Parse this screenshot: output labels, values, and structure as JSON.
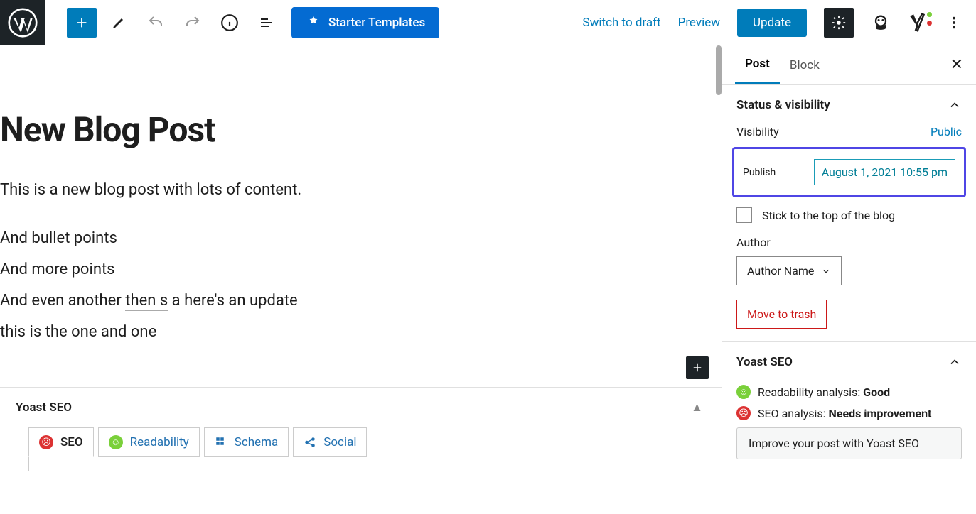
{
  "toolbar": {
    "starter_templates": "Starter Templates",
    "switch_draft": "Switch to draft",
    "preview": "Preview",
    "update": "Update"
  },
  "editor": {
    "title": "New Blog Post",
    "p1": "This is a new blog post with lots of content.",
    "l1": "And bullet points",
    "l2": "And more points",
    "l3a": "And even another ",
    "l3u": "then s",
    "l3b": " a here's an update",
    "l4": "this is the one and one"
  },
  "yoast_bottom": {
    "title": "Yoast SEO",
    "tab_seo": "SEO",
    "tab_readability": "Readability",
    "tab_schema": "Schema",
    "tab_social": "Social"
  },
  "sidebar": {
    "tab_post": "Post",
    "tab_block": "Block",
    "status_panel": {
      "title": "Status & visibility",
      "visibility_label": "Visibility",
      "visibility_value": "Public",
      "publish_label": "Publish",
      "publish_value": "August 1, 2021 10:55 pm",
      "sticky_label": "Stick to the top of the blog",
      "author_label": "Author",
      "author_value": "Author Name",
      "trash": "Move to trash"
    },
    "yoast_panel": {
      "title": "Yoast SEO",
      "readability_label": "Readability analysis: ",
      "readability_value": "Good",
      "seo_label": "SEO analysis: ",
      "seo_value": "Needs improvement",
      "improve": "Improve your post with Yoast SEO"
    }
  }
}
